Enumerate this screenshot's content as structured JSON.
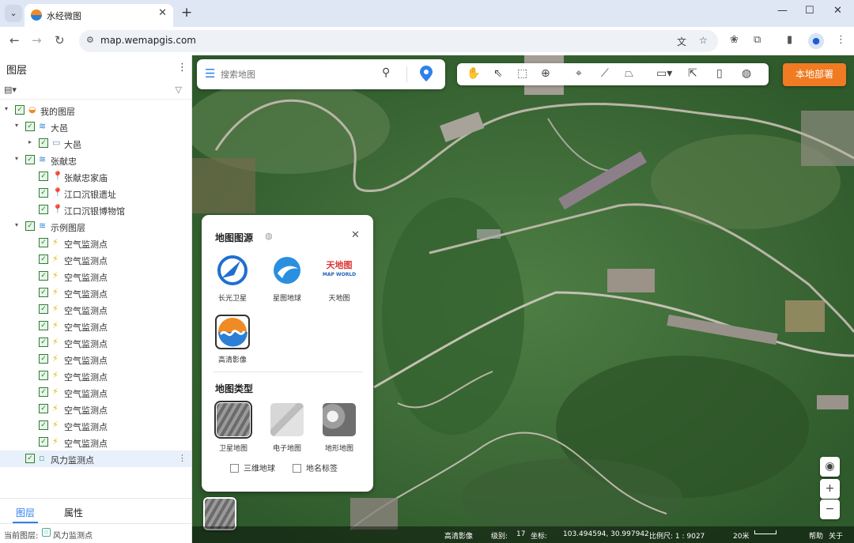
{
  "browser": {
    "tab_title": "水经微图",
    "url": "map.wemapgis.com"
  },
  "sidebar": {
    "title": "图层",
    "tree": [
      {
        "label": "我的图层",
        "level": 0,
        "arrow": true,
        "icon": "app-logo-icon"
      },
      {
        "label": "大邑",
        "level": 1,
        "arrow": true,
        "icon": "layer-stack-icon"
      },
      {
        "label": "大邑",
        "level": 2,
        "arrow": true,
        "icon": "folder-icon"
      },
      {
        "label": "张献忠",
        "level": 1,
        "arrow": true,
        "icon": "layer-stack-icon"
      },
      {
        "label": "张献忠家庙",
        "level": 2,
        "arrow": false,
        "icon": "map-pin-icon"
      },
      {
        "label": "江口沉银遗址",
        "level": 2,
        "arrow": false,
        "icon": "map-pin-icon"
      },
      {
        "label": "江口沉银博物馆",
        "level": 2,
        "arrow": false,
        "icon": "map-pin-icon"
      },
      {
        "label": "示例图层",
        "level": 1,
        "arrow": true,
        "icon": "layer-stack-icon"
      },
      {
        "label": "空气监测点",
        "level": 2,
        "arrow": false,
        "icon": "lightning-icon"
      },
      {
        "label": "空气监测点",
        "level": 2,
        "arrow": false,
        "icon": "lightning-icon"
      },
      {
        "label": "空气监测点",
        "level": 2,
        "arrow": false,
        "icon": "lightning-icon"
      },
      {
        "label": "空气监测点",
        "level": 2,
        "arrow": false,
        "icon": "lightning-icon"
      },
      {
        "label": "空气监测点",
        "level": 2,
        "arrow": false,
        "icon": "lightning-icon"
      },
      {
        "label": "空气监测点",
        "level": 2,
        "arrow": false,
        "icon": "lightning-icon"
      },
      {
        "label": "空气监测点",
        "level": 2,
        "arrow": false,
        "icon": "lightning-icon"
      },
      {
        "label": "空气监测点",
        "level": 2,
        "arrow": false,
        "icon": "lightning-icon"
      },
      {
        "label": "空气监测点",
        "level": 2,
        "arrow": false,
        "icon": "lightning-icon"
      },
      {
        "label": "空气监测点",
        "level": 2,
        "arrow": false,
        "icon": "lightning-icon"
      },
      {
        "label": "空气监测点",
        "level": 2,
        "arrow": false,
        "icon": "lightning-icon"
      },
      {
        "label": "空气监测点",
        "level": 2,
        "arrow": false,
        "icon": "lightning-icon"
      },
      {
        "label": "空气监测点",
        "level": 2,
        "arrow": false,
        "icon": "lightning-icon"
      },
      {
        "label": "风力监测点",
        "level": 1,
        "arrow": false,
        "icon": "image-layer-icon",
        "selected": true
      }
    ],
    "tabs": [
      "图层",
      "属性"
    ],
    "status_label": "当前图层:",
    "status_value": "风力监测点"
  },
  "map": {
    "search_placeholder": "搜索地图",
    "deploy_button": "本地部署",
    "tools": [
      "pan-hand-icon",
      "select-arrow-icon",
      "box-select-icon",
      "zoom-region-icon",
      "marker-icon",
      "polyline-icon",
      "polygon-icon",
      "measure-ruler-icon",
      "pointer-info-icon",
      "tablet-icon",
      "globe-icon"
    ],
    "source_panel": {
      "heading_source": "地图图源",
      "sources": [
        {
          "label": "长光卫星",
          "icon": "changguang-satellite-logo"
        },
        {
          "label": "星图地球",
          "icon": "geovis-earth-logo"
        },
        {
          "label": "天地图",
          "icon": "tianditu-logo"
        },
        {
          "label": "高清影像",
          "icon": "hd-imagery-logo",
          "active": true
        }
      ],
      "tianditu_logo_text": "天地图",
      "tianditu_logo_sub": "MAP WORLD",
      "heading_type": "地图类型",
      "types": [
        {
          "label": "卫星地图",
          "active": true
        },
        {
          "label": "电子地图"
        },
        {
          "label": "地形地图"
        }
      ],
      "checkbox_3d": "三维地球",
      "checkbox_labels": "地名标签"
    },
    "status": {
      "layer": "高清影像",
      "level_label": "级别:",
      "level_value": "17",
      "coord_label": "坐标:",
      "coords": "103.494594, 30.997942",
      "scale": "比例尺: 1 : 9027",
      "distance": "20米",
      "help": "帮助",
      "about": "关于"
    }
  },
  "colors": {
    "accent_blue": "#2f80ed",
    "deploy_orange": "#f07b22",
    "check_green": "#2e7d32"
  }
}
